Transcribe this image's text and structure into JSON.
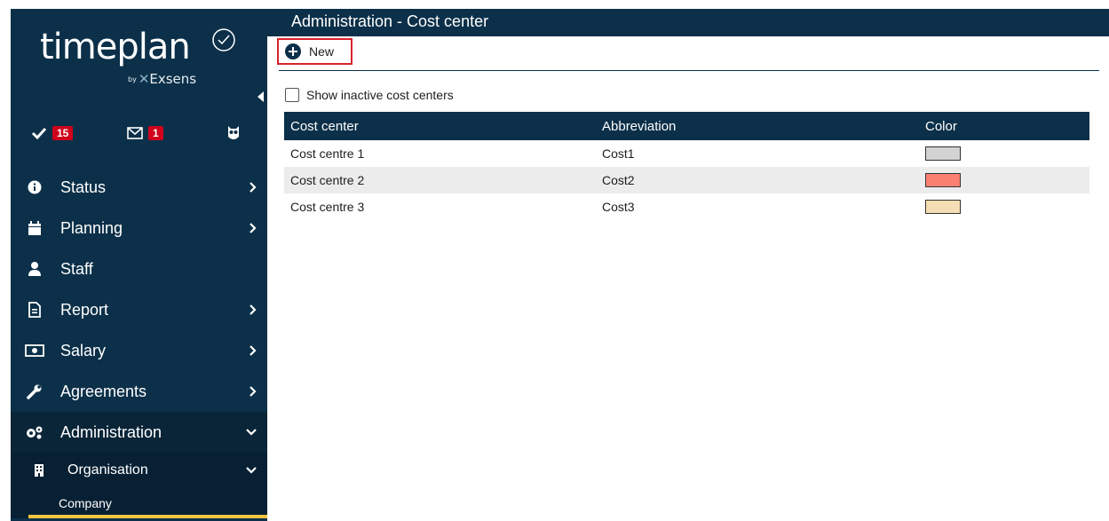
{
  "app": {
    "logo_text": "timeplan",
    "logo_by": "by",
    "logo_brand": "Exsens"
  },
  "sidebar": {
    "tasks_badge": "15",
    "messages_badge": "1",
    "icons": [
      "check-icon",
      "envelope-icon",
      "owl-icon"
    ],
    "items": [
      {
        "label": "Status",
        "icon": "info-circle-icon",
        "has_chevron": true
      },
      {
        "label": "Planning",
        "icon": "calendar-icon",
        "has_chevron": true
      },
      {
        "label": "Staff",
        "icon": "user-icon",
        "has_chevron": false
      },
      {
        "label": "Report",
        "icon": "file-icon",
        "has_chevron": true
      },
      {
        "label": "Salary",
        "icon": "money-icon",
        "has_chevron": true
      },
      {
        "label": "Agreements",
        "icon": "wrench-icon",
        "has_chevron": true
      },
      {
        "label": "Administration",
        "icon": "cogs-icon",
        "has_chevron": true,
        "expanded": true
      }
    ],
    "sub_items": [
      {
        "label": "Organisation",
        "icon": "building-icon",
        "expanded": true
      }
    ],
    "sub_sub_items": [
      {
        "label": "Company"
      }
    ]
  },
  "header": {
    "title": "Administration - Cost center"
  },
  "toolbar": {
    "new_label": "New"
  },
  "filter": {
    "show_inactive_label": "Show inactive cost centers",
    "show_inactive_checked": false
  },
  "table": {
    "columns": [
      "Cost center",
      "Abbreviation",
      "Color"
    ],
    "rows": [
      {
        "name": "Cost centre 1",
        "abbr": "Cost1",
        "color": "#d3d3d3"
      },
      {
        "name": "Cost centre 2",
        "abbr": "Cost2",
        "color": "#fa8072"
      },
      {
        "name": "Cost centre 3",
        "abbr": "Cost3",
        "color": "#f5deb3"
      }
    ]
  },
  "colors": {
    "primary": "#0c3049",
    "highlight_border": "#d8222b",
    "badge": "#d0021b",
    "active_underline": "#f4c542"
  }
}
